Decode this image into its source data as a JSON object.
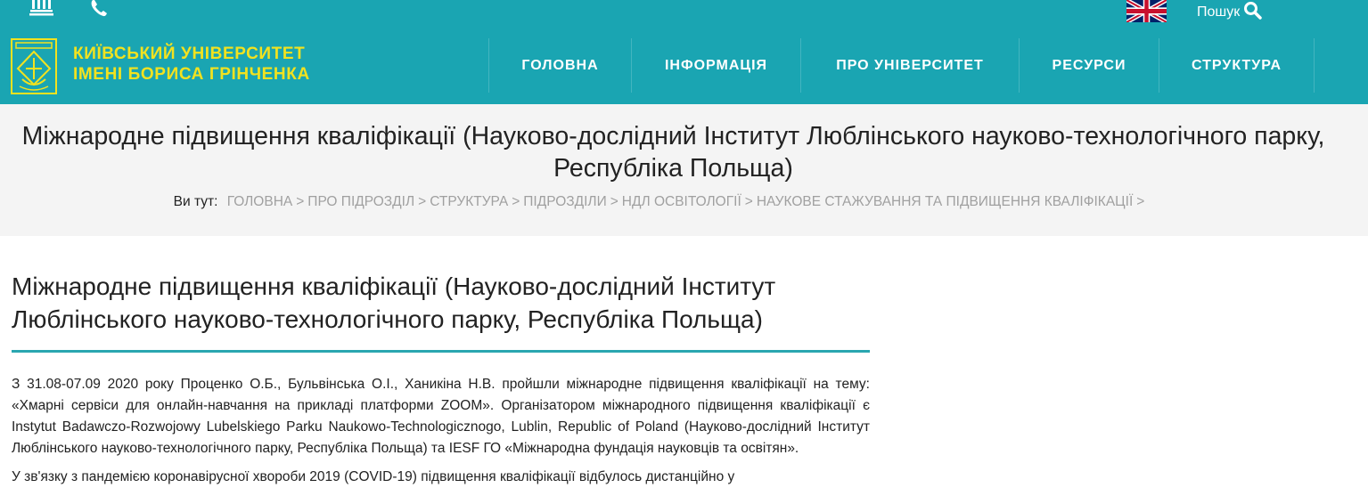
{
  "header": {
    "search_label": "Пошук",
    "brand_line1": "КИЇВСЬКИЙ УНІВЕРСИТЕТ",
    "brand_line2": "ІМЕНІ БОРИСА ГРІНЧЕНКА",
    "nav": [
      {
        "label": "ГОЛОВНА"
      },
      {
        "label": "ІНФОРМАЦІЯ"
      },
      {
        "label": "ПРО УНІВЕРСИТЕТ"
      },
      {
        "label": "РЕСУРСИ"
      },
      {
        "label": "СТРУКТУРА"
      }
    ],
    "icons": [
      "university-icon",
      "phone-icon",
      "uk-flag-icon",
      "search-icon",
      "logo-icon"
    ]
  },
  "band": {
    "title": "Міжнародне підвищення кваліфікації (Науково-дослідний Інститут Люблінського науково-технологічного парку, Республіка Польща)",
    "breadcrumb_label": "Ви тут:",
    "breadcrumbs": [
      "ГОЛОВНА",
      "ПРО ПІДРОЗДІЛ",
      "СТРУКТУРА",
      "ПІДРОЗДІЛИ",
      "НДЛ ОСВІТОЛОГІЇ",
      "НАУКОВЕ СТАЖУВАННЯ ТА ПІДВИЩЕННЯ КВАЛІФІКАЦІЇ"
    ],
    "separator": ">"
  },
  "article": {
    "title": "Міжнародне підвищення кваліфікації (Науково-дослідний Інститут Люблінського науково-технологічного парку, Республіка Польща)",
    "paragraph1": "З 31.08-07.09 2020 року Проценко О.Б., Бульвінська О.І., Ханикіна Н.В. пройшли міжнародне підвищення кваліфікації на тему: «Хмарні сервіси для онлайн-навчання на прикладі платформи ZOOM». Організатором міжнародного підвищення кваліфікації є Instytut Badawczo-Rozwojowy Lubelskiego Parku Naukowo-Technologicznogo, Lublin, Republic of Poland (Науково-дослідний Інститут Люблінського науково-технологічного парку, Республіка Польща) та IESF ГО «Міжнародна фундація науковців та освітян».",
    "paragraph2": "У зв'язку з пандемією коронавірусної хвороби 2019 (COVID-19) підвищення кваліфікації відбулось дистанційно у"
  },
  "colors": {
    "header_bg": "#1aa5b2",
    "brand_yellow": "#f2e21f",
    "band_bg": "#f4f4f4",
    "accent_rule": "#2aa6b0"
  }
}
